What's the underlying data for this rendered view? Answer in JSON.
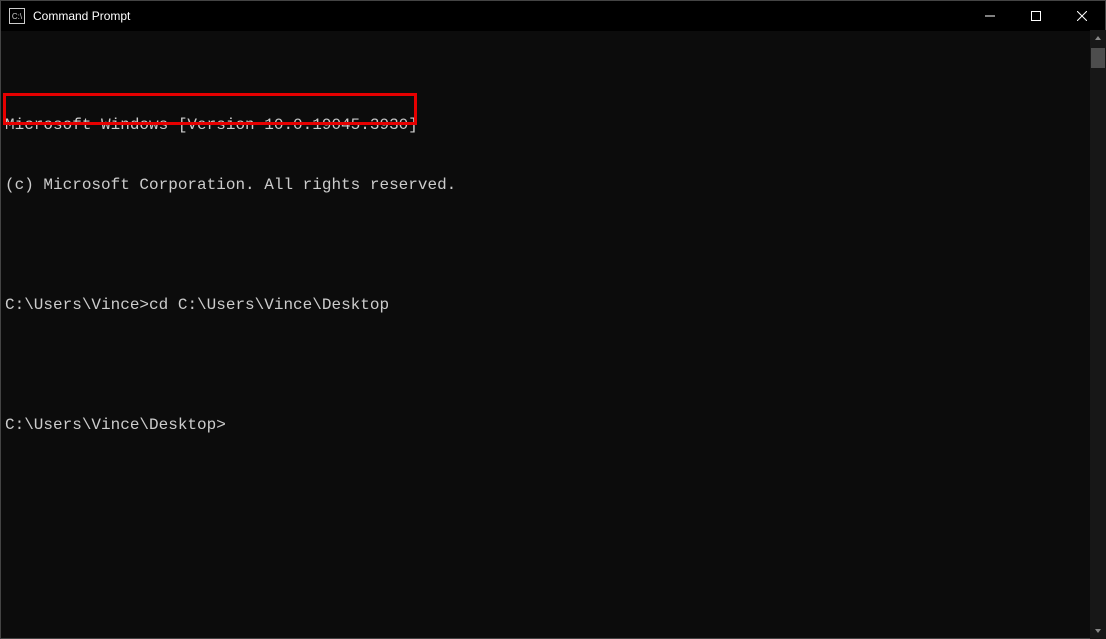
{
  "titlebar": {
    "app_icon_label": "C:\\",
    "title": "Command Prompt"
  },
  "terminal": {
    "line1": "Microsoft Windows [Version 10.0.19045.3930]",
    "line2": "(c) Microsoft Corporation. All rights reserved.",
    "line3_prompt": "C:\\Users\\Vince>",
    "line3_command": "cd C:\\Users\\Vince\\Desktop",
    "line4_prompt": "C:\\Users\\Vince\\Desktop>"
  }
}
